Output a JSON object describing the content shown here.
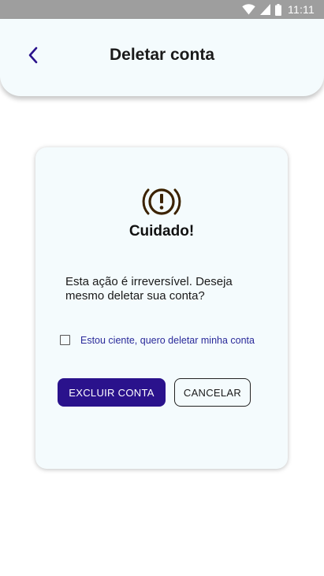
{
  "status_bar": {
    "time": "11:11",
    "icons": [
      "wifi-icon",
      "cellular-signal-icon",
      "battery-icon"
    ]
  },
  "header": {
    "back_icon": "chevron-left-icon",
    "title": "Deletar conta"
  },
  "dialog": {
    "icon": "warning-exclamation-icon",
    "title": "Cuidado!",
    "message": "Esta ação é irreversível. Deseja mesmo deletar sua conta?",
    "confirm_checkbox": {
      "checked": false,
      "label": "Estou ciente, quero deletar minha conta"
    },
    "delete_button": "EXCLUIR CONTA",
    "cancel_button": "CANCELAR"
  },
  "colors": {
    "primary": "#2a128c",
    "accent_text": "#2a2a9a",
    "icon_brown": "#3b2200",
    "header_bg": "#f4fbfd",
    "status_bar": "#9e9e9e"
  }
}
